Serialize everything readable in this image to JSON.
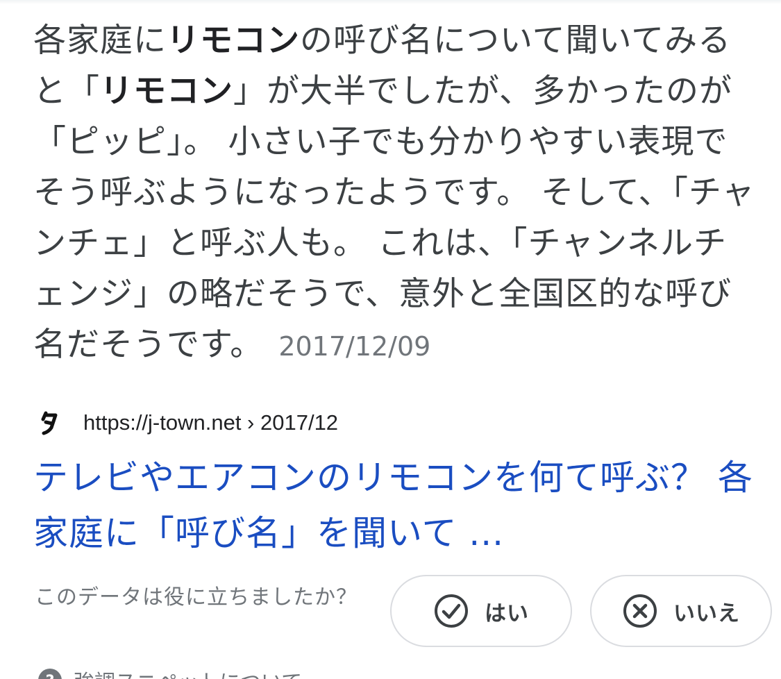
{
  "snippet": {
    "seg1": "各家庭に",
    "bold1": "リモコン",
    "seg2": "の呼び名について聞いてみると「",
    "bold2": "リモコン",
    "seg3": "」が大半でしたが、多かったのが「ピッピ」。 小さい子でも分かりやすい表現でそう呼ぶようになったようです。 そして、「チャンチェ」と呼ぶ人も。 これは、「チャンネルチェンジ」の略だそうで、意外と全国区的な呼び名だそうです。",
    "date": "2017/12/09"
  },
  "source": {
    "favicon_glyph": "タ",
    "url": "https://j-town.net › 2017/12"
  },
  "result": {
    "title": "テレビやエアコンのリモコンを何て呼ぶ？ 各家庭に「呼び名」を聞いて ..."
  },
  "feedback": {
    "question": "このデータは役に立ちましたか？",
    "yes_label": "はい",
    "no_label": "いいえ",
    "yes_icon": "check-circle-icon",
    "no_icon": "x-circle-icon"
  },
  "footer": {
    "text": "強調スニペットについて",
    "icon": "help-circle-icon"
  },
  "colors": {
    "link": "#1a4dc1",
    "body_text": "#3c4043",
    "muted_text": "#70757a",
    "button_border": "#dadce0"
  }
}
